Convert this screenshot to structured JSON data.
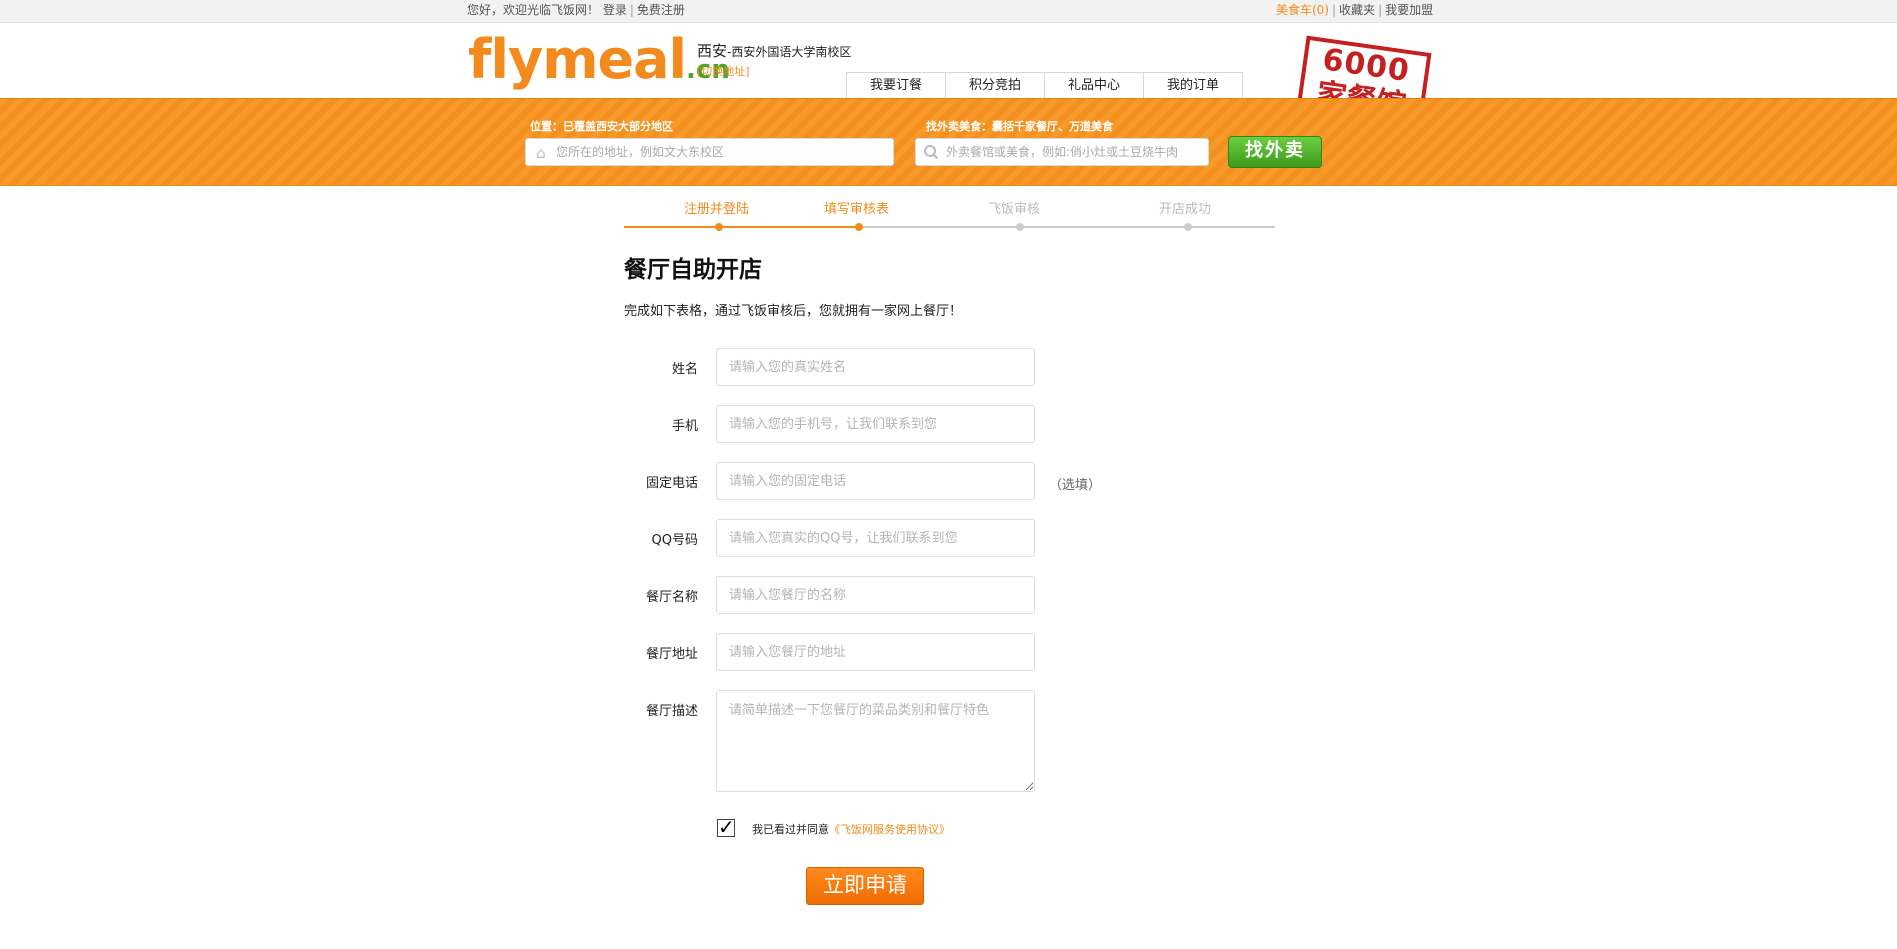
{
  "topbar": {
    "greeting": "您好，欢迎光临飞饭网！",
    "login": "登录",
    "register": "免费注册",
    "cart_label": "美食车(0)",
    "favorites": "收藏夹",
    "join": "我要加盟"
  },
  "header": {
    "logo_main": "flymeal",
    "logo_suffix": ".cn",
    "city": "西安",
    "campus": "-西安外国语大学南校区",
    "switch_address": "[切换地址]",
    "nav": [
      "我要订餐",
      "积分竞拍",
      "礼品中心",
      "我的订单"
    ],
    "stamp_number": "6000",
    "stamp_text": "家餐馆"
  },
  "search": {
    "location_label": "位置：已覆盖西安大部分地区",
    "location_placeholder": "您所在的地址，例如文大东校区",
    "food_label": "找外卖美食：囊括千家餐厅、万道美食",
    "food_placeholder": "外卖餐馆或美食，例如:俏小灶或土豆烧牛肉",
    "find_button": "找外卖"
  },
  "steps": [
    {
      "label": "注册并登陆",
      "state": "done"
    },
    {
      "label": "填写审核表",
      "state": "current"
    },
    {
      "label": "飞饭审核",
      "state": "todo"
    },
    {
      "label": "开店成功",
      "state": "todo"
    }
  ],
  "colors": {
    "accent": "#f08c1c",
    "inactive": "#bbbbbb",
    "stamp": "#c42020",
    "green": "#46a62c"
  },
  "form": {
    "title": "餐厅自助开店",
    "description": "完成如下表格，通过飞饭审核后，您就拥有一家网上餐厅！",
    "fields": [
      {
        "label": "姓名",
        "placeholder": "请输入您的真实姓名"
      },
      {
        "label": "手机",
        "placeholder": "请输入您的手机号，让我们联系到您"
      },
      {
        "label": "固定电话",
        "placeholder": "请输入您的固定电话"
      },
      {
        "label": "QQ号码",
        "placeholder": "请输入您真实的QQ号，让我们联系到您"
      },
      {
        "label": "餐厅名称",
        "placeholder": "请输入您餐厅的名称"
      },
      {
        "label": "餐厅地址",
        "placeholder": "请输入您餐厅的地址"
      },
      {
        "label": "餐厅描述",
        "placeholder": "请简单描述一下您餐厅的菜品类别和餐厅特色"
      }
    ],
    "optional_note": "（选填）",
    "agree_text": "我已看过并同意",
    "agree_link": "《飞饭网服务使用协议》",
    "submit": "立即申请"
  }
}
